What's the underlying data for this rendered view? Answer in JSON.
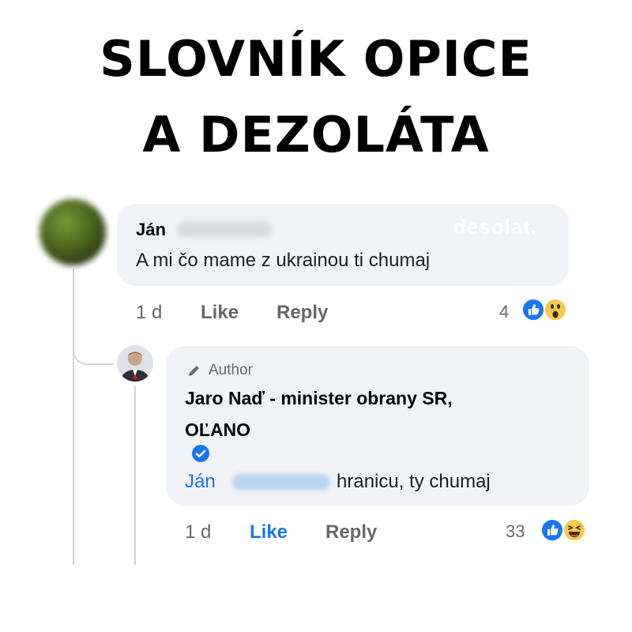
{
  "headline": {
    "line1": "SLOVNÍK OPICE",
    "line2": "A DEZOLÁTA"
  },
  "comment": {
    "name": "Ján",
    "text": "A mi čo mame z ukrainou ti chumaj",
    "watermark": "desolat.",
    "time": "1 d",
    "like_label": "Like",
    "reply_label": "Reply",
    "reaction_count": "4",
    "reactions": [
      "like-icon",
      "wow-icon"
    ]
  },
  "reply": {
    "author_badge": "Author",
    "name_line1": "Jaro Naď - minister obrany SR,",
    "name_line2": "OĽANO",
    "mention": "Ján",
    "text": "hranicu, ty chumaj",
    "time": "1 d",
    "like_label": "Like",
    "reply_label": "Reply",
    "reaction_count": "33",
    "reactions": [
      "like-icon",
      "haha-icon"
    ]
  },
  "colors": {
    "link": "#1877f2",
    "bubble": "#f0f2f5",
    "meta": "#65676b"
  }
}
